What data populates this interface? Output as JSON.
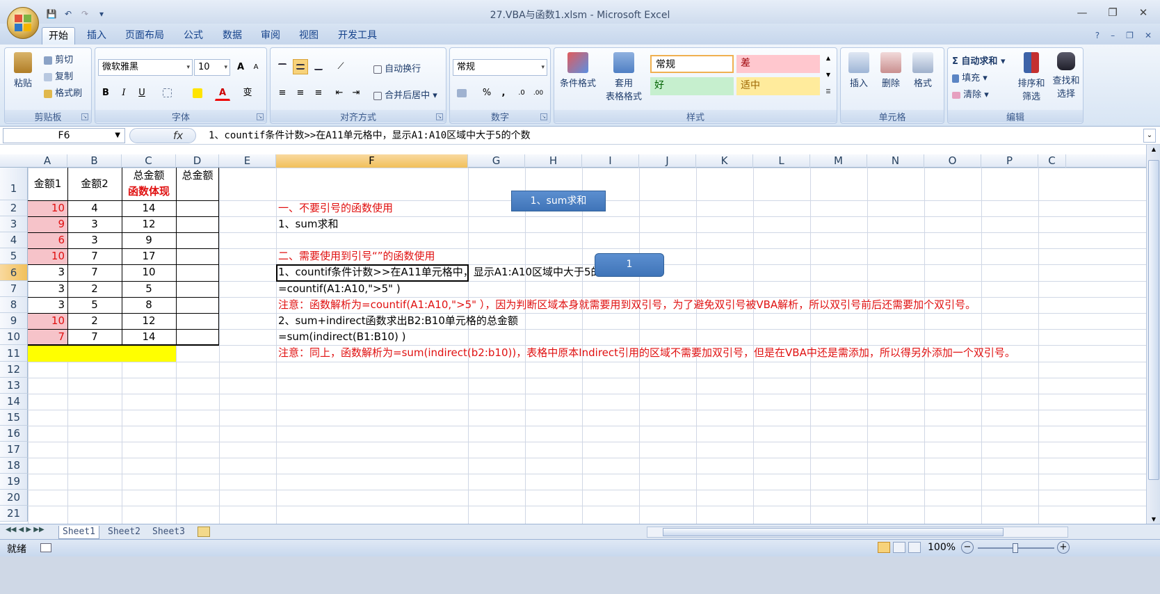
{
  "window": {
    "title": "27.VBA与函数1.xlsm - Microsoft Excel",
    "controls": [
      "—",
      "❐",
      "✕"
    ]
  },
  "qat": {
    "save": "💾",
    "undo": "↶",
    "redo": "↷",
    "customize": "▾"
  },
  "tabs": [
    "开始",
    "插入",
    "页面布局",
    "公式",
    "数据",
    "审阅",
    "视图",
    "开发工具"
  ],
  "help_controls": [
    "?",
    "–",
    "❐",
    "✕"
  ],
  "ribbon": {
    "clipboard": {
      "label": "剪贴板",
      "paste": "粘贴",
      "cut": "剪切",
      "copy": "复制",
      "format_painter": "格式刷"
    },
    "font": {
      "label": "字体",
      "name": "微软雅黑",
      "size": "10",
      "grow": "A",
      "shrink": "A",
      "bold": "B",
      "italic": "I",
      "underline": "U",
      "font_color": "A",
      "phonetic": "变"
    },
    "alignment": {
      "label": "对齐方式",
      "wrap": "自动换行",
      "merge": "合并后居中"
    },
    "number": {
      "label": "数字",
      "format": "常规",
      "percent": "%",
      "comma": ",",
      "inc": ".0",
      "dec": ".00"
    },
    "styles": {
      "label": "样式",
      "conditional": "条件格式",
      "table_fmt_1": "套用",
      "table_fmt_2": "表格格式",
      "normal": "常规",
      "bad": "差",
      "good": "好",
      "neutral": "适中"
    },
    "cells": {
      "label": "单元格",
      "insert": "插入",
      "delete": "删除",
      "format": "格式"
    },
    "editing": {
      "label": "编辑",
      "autosum": "Σ 自动求和",
      "fill": "填充",
      "clear": "清除",
      "sort_1": "排序和",
      "sort_2": "筛选",
      "find_1": "查找和",
      "find_2": "选择"
    }
  },
  "formula_bar": {
    "name_box": "F6",
    "fx": "fx",
    "formula": "1、countif条件计数>>在A11单元格中，显示A1:A10区域中大于5的个数"
  },
  "columns": [
    "A",
    "B",
    "C",
    "D",
    "E",
    "F",
    "G",
    "H",
    "I",
    "J",
    "K",
    "L",
    "M",
    "N",
    "O",
    "P",
    "C"
  ],
  "rows": [
    "1",
    "2",
    "3",
    "4",
    "5",
    "6",
    "7",
    "8",
    "9",
    "10",
    "11",
    "12",
    "13",
    "14",
    "15",
    "16",
    "17",
    "18",
    "19",
    "20",
    "21"
  ],
  "table": {
    "header": {
      "a": "金额1",
      "b": "金额2",
      "c1": "总金额",
      "c2": "函数体现",
      "d": "总金额"
    },
    "rows": [
      {
        "a": "10",
        "b": "4",
        "c": "14",
        "hl": true
      },
      {
        "a": "9",
        "b": "3",
        "c": "12",
        "hl": true
      },
      {
        "a": "6",
        "b": "3",
        "c": "9",
        "hl": true
      },
      {
        "a": "10",
        "b": "7",
        "c": "17",
        "hl": true
      },
      {
        "a": "3",
        "b": "7",
        "c": "10",
        "hl": false
      },
      {
        "a": "3",
        "b": "2",
        "c": "5",
        "hl": false
      },
      {
        "a": "3",
        "b": "5",
        "c": "8",
        "hl": false
      },
      {
        "a": "10",
        "b": "2",
        "c": "12",
        "hl": true
      },
      {
        "a": "7",
        "b": "7",
        "c": "14",
        "hl": true
      }
    ]
  },
  "notes": {
    "f2": "一、不要引号的函数使用",
    "f3": "1、sum求和",
    "f5": "二、需要使用到引号“”的函数使用",
    "f6": "1、countif条件计数>>在A11单元格中，显示A1:A10区域中大于5的个数",
    "f7": "=countif(A1:A10,\">5\" )",
    "f8": "注意：函数解析为=countif(A1:A10,\">5\" ），因为判断区域本身就需要用到双引号，为了避免双引号被VBA解析，所以双引号前后还需要加个双引号。",
    "f9": "2、sum+indirect函数求出B2:B10单元格的总金额",
    "f10": "=sum(indirect(B1:B10) )",
    "f11": "注意：同上，函数解析为=sum(indirect(b2:b10))，表格中原本Indirect引用的区域不需要加双引号，但是在VBA中还是需添加，所以得另外添加一个双引号。"
  },
  "buttons": {
    "sum": "1、sum求和",
    "countif": "1"
  },
  "sheets": [
    "Sheet1",
    "Sheet2",
    "Sheet3"
  ],
  "status": {
    "ready": "就绪",
    "zoom": "100%"
  },
  "colors": {
    "accent": "#15428b",
    "pink": "#f6c3c9",
    "yellow": "#ffff00",
    "red": "#e01010",
    "selected": "#f5c96b"
  }
}
